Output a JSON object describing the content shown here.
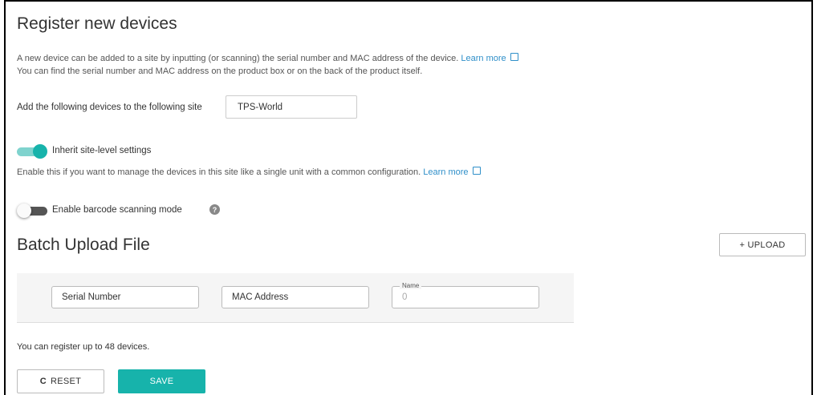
{
  "page": {
    "title": "Register new devices",
    "description_line1": "A new device can be added to a site by inputting (or scanning) the serial number and MAC address of the device.",
    "learn_more": "Learn more",
    "description_line2": "You can find the serial number and MAC address on the product box or on the back of the product itself."
  },
  "site": {
    "label": "Add the following devices to the following site",
    "value": "TPS-World"
  },
  "inherit": {
    "label": "Inherit site-level settings",
    "enabled": true,
    "description": "Enable this if you want to manage the devices in this site like a single unit with a common configuration.",
    "learn_more": "Learn more"
  },
  "barcode": {
    "label": "Enable barcode scanning mode",
    "enabled": false,
    "help_icon": "?"
  },
  "batch": {
    "title": "Batch Upload File",
    "upload_label": "+ UPLOAD"
  },
  "device_row": {
    "serial_placeholder": "Serial Number",
    "mac_placeholder": "MAC Address",
    "name_label": "Name",
    "name_value": "0"
  },
  "limit_text": "You can register up to 48 devices.",
  "actions": {
    "reset_icon": "C",
    "reset_label": "RESET",
    "save_label": "SAVE"
  },
  "colors": {
    "accent": "#17b3ab",
    "link": "#2f8fc9"
  }
}
